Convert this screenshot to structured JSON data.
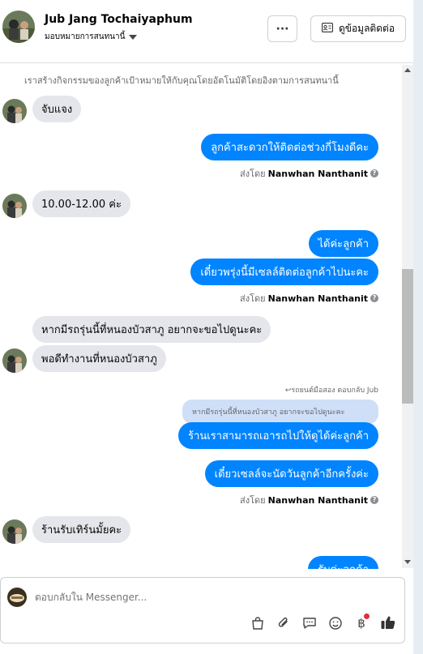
{
  "header": {
    "contact_name": "Jub Jang Tochaiyaphum",
    "assign_label": "มอบหมายการสนทนานี้",
    "more_label": "···",
    "contact_info_label": "ดูข้อมูลติดต่อ"
  },
  "system_note": "เราสร้างกิจกรรมของลูกค้าเป้าหมายให้กับคุณโดยอัตโนมัติโดยอิงตามการสนทนานี้",
  "messages": {
    "m1": "จับแจง",
    "m2": "ลูกค้าสะดวกให้ติดต่อช่วงกี่โมงดีคะ",
    "sent_prefix": "ส่งโดย",
    "agent_name": "Nanwhan Nanthanit",
    "m3": "10.00-12.00 ค่ะ",
    "m4": "ได้ค่ะลูกค้า",
    "m5": "เดี๋ยวพรุ่งนี้มีเซลล์ติดต่อลูกค้าไปนะคะ",
    "m6": "หากมีรถรุ่นนี้ที่หนองบัวสาภู อยากจะขอไปดูนะคะ",
    "m7": "พอดีทำงานที่หนองบัวสาภู",
    "reply_context": "↩รถยนต์มือสอง ตอบกลับ Jub",
    "quoted": "หากมีรถรุ่นนี้ที่หนองบัวสาภู อยากจะขอไปดูนะคะ",
    "m8": "ร้านเราสามารถเอารถไปให้ดูได้ค่ะลูกค้า",
    "m9": "เดี๋ยวเซลล์จะนัดวันลูกค้าอีกครั้งค่ะ",
    "m10": "ร้านรับเทิร์นมั้ยคะ",
    "m11": "รับค่ะลูกค้า"
  },
  "composer": {
    "placeholder": "ตอบกลับใน Messenger..."
  },
  "toolbar_icons": [
    "shopping-bag-icon",
    "attachment-icon",
    "saved-reply-icon",
    "emoji-icon",
    "baht-payment-icon",
    "thumbs-up-icon"
  ],
  "colors": {
    "outgoing_bubble": "#0084ff",
    "incoming_bubble": "#e4e6eb",
    "quoted_bubble": "#cfdff7",
    "notification_dot": "#e02f3a"
  }
}
